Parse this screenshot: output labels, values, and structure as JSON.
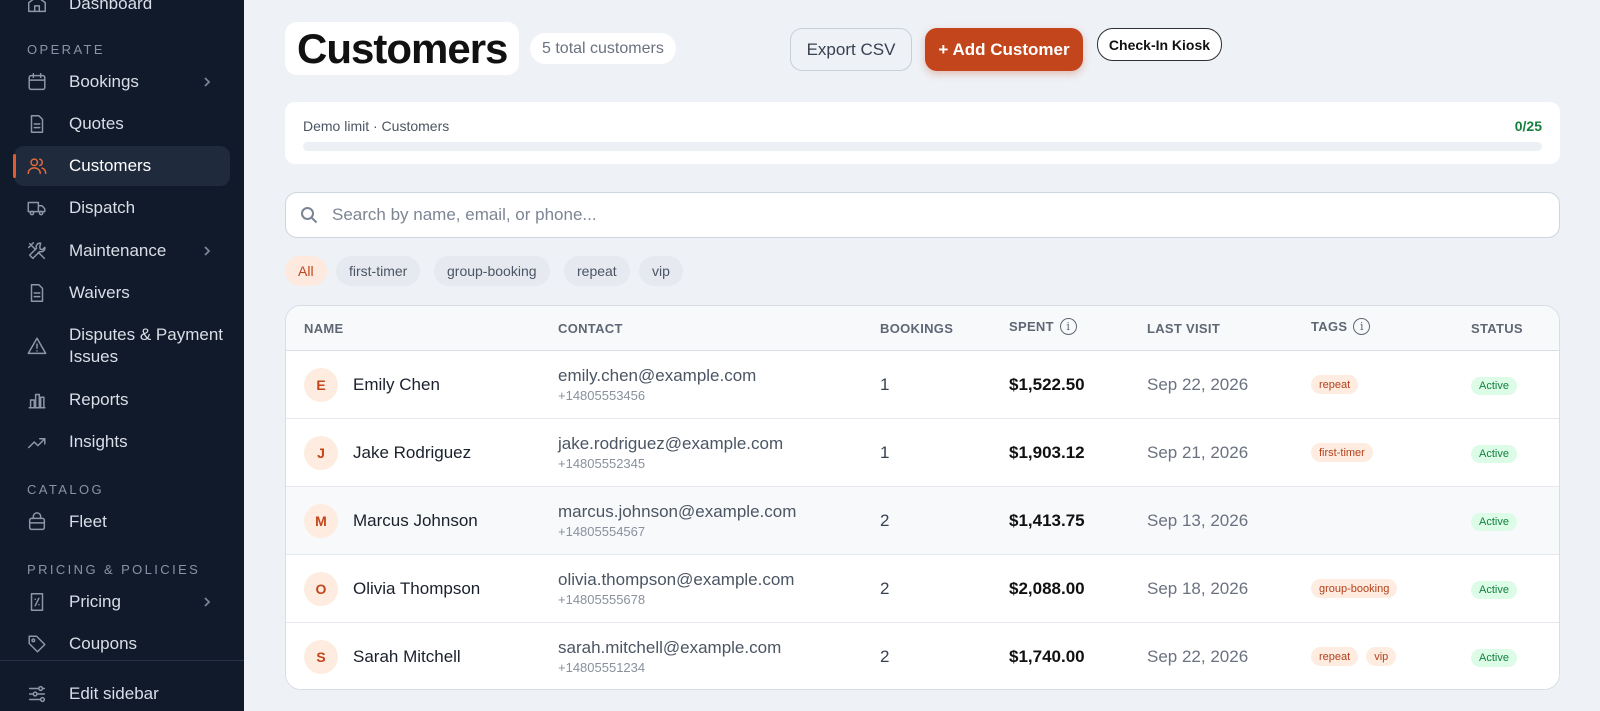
{
  "sidebar": {
    "top_item": "Dashboard",
    "sections": {
      "operate": "OPERATE",
      "catalog": "CATALOG",
      "pricing": "PRICING & POLICIES"
    },
    "items": {
      "bookings": "Bookings",
      "quotes": "Quotes",
      "customers": "Customers",
      "dispatch": "Dispatch",
      "maintenance": "Maintenance",
      "waivers": "Waivers",
      "disputes": "Disputes & Payment Issues",
      "reports": "Reports",
      "insights": "Insights",
      "fleet": "Fleet",
      "pricing": "Pricing",
      "coupons": "Coupons",
      "edit_sidebar": "Edit sidebar"
    }
  },
  "header": {
    "title": "Customers",
    "count": "5 total customers",
    "export_label": "Export CSV",
    "add_label": "+ Add Customer",
    "kiosk_label": "Check-In Kiosk"
  },
  "limit": {
    "label": "Demo limit · Customers",
    "count": "0/25",
    "fraction": 0
  },
  "search": {
    "placeholder": "Search by name, email, or phone..."
  },
  "filters": [
    "All",
    "first-timer",
    "group-booking",
    "repeat",
    "vip"
  ],
  "table": {
    "headers": {
      "name": "NAME",
      "contact": "CONTACT",
      "bookings": "BOOKINGS",
      "spent": "SPENT",
      "last_visit": "LAST VISIT",
      "tags": "TAGS",
      "status": "STATUS"
    },
    "rows": [
      {
        "initial": "E",
        "name": "Emily Chen",
        "email": "emily.chen@example.com",
        "phone": "+14805553456",
        "bookings": "1",
        "spent": "$1,522.50",
        "last_visit": "Sep 22, 2026",
        "tags": [
          "repeat"
        ],
        "status": "Active"
      },
      {
        "initial": "J",
        "name": "Jake Rodriguez",
        "email": "jake.rodriguez@example.com",
        "phone": "+14805552345",
        "bookings": "1",
        "spent": "$1,903.12",
        "last_visit": "Sep 21, 2026",
        "tags": [
          "first-timer"
        ],
        "status": "Active"
      },
      {
        "initial": "M",
        "name": "Marcus Johnson",
        "email": "marcus.johnson@example.com",
        "phone": "+14805554567",
        "bookings": "2",
        "spent": "$1,413.75",
        "last_visit": "Sep 13, 2026",
        "tags": [],
        "status": "Active"
      },
      {
        "initial": "O",
        "name": "Olivia Thompson",
        "email": "olivia.thompson@example.com",
        "phone": "+14805555678",
        "bookings": "2",
        "spent": "$2,088.00",
        "last_visit": "Sep 18, 2026",
        "tags": [
          "group-booking"
        ],
        "status": "Active"
      },
      {
        "initial": "S",
        "name": "Sarah Mitchell",
        "email": "sarah.mitchell@example.com",
        "phone": "+14805551234",
        "bookings": "2",
        "spent": "$1,740.00",
        "last_visit": "Sep 22, 2026",
        "tags": [
          "repeat",
          "vip"
        ],
        "status": "Active"
      }
    ]
  },
  "colors": {
    "accent": "#c2451c",
    "sidebar_bg": "#111a2b",
    "success": "#15803d"
  }
}
